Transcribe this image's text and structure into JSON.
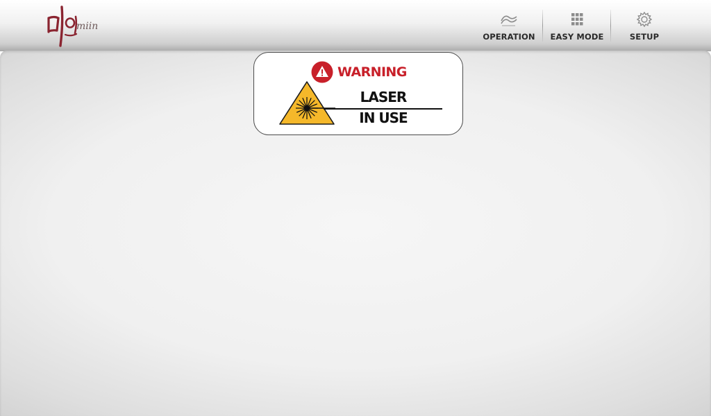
{
  "header": {
    "logo": {
      "name": "miin-logo",
      "script_text": "miin",
      "color": "#8a2430"
    },
    "nav": [
      {
        "label": "OPERATION",
        "icon": "wave-icon"
      },
      {
        "label": "EASY MODE",
        "icon": "grid-icon"
      },
      {
        "label": "SETUP",
        "icon": "gear-icon"
      }
    ]
  },
  "warning": {
    "title": "WARNING",
    "line1": "LASER",
    "line2": "IN USE",
    "icon": "warning-icon",
    "symbol": "laser-hazard-icon",
    "colors": {
      "accent": "#c8202a",
      "hazard_yellow": "#f5b82a"
    }
  }
}
